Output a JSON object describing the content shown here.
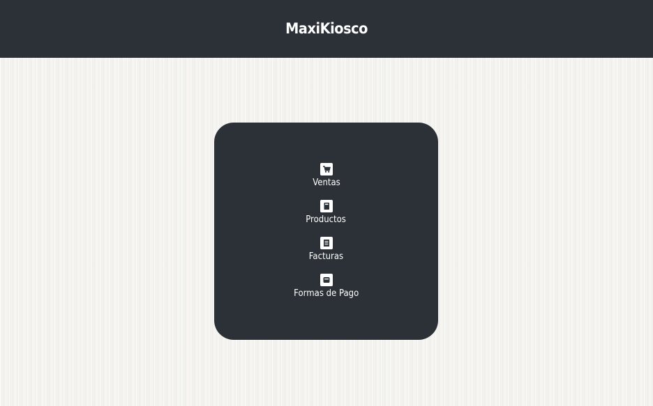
{
  "header": {
    "title": "MaxiKiosco"
  },
  "menu": {
    "items": [
      {
        "label": "Ventas",
        "icon": "shopping-cart-icon"
      },
      {
        "label": "Productos",
        "icon": "book-icon"
      },
      {
        "label": "Facturas",
        "icon": "document-icon"
      },
      {
        "label": "Formas de Pago",
        "icon": "wallet-icon"
      }
    ]
  },
  "colors": {
    "header_bg": "#2b3136",
    "card_bg": "#2b3136",
    "page_bg": "#f4f3ef",
    "text": "#ffffff"
  }
}
